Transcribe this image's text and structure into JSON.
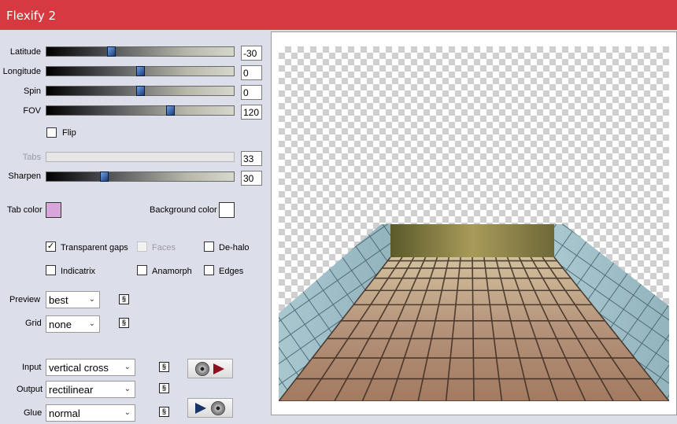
{
  "window": {
    "title": "Flexify 2"
  },
  "sliders": [
    {
      "label": "Latitude",
      "value": "-30",
      "thumb_pct": 0.34,
      "enabled": true
    },
    {
      "label": "Longitude",
      "value": "0",
      "thumb_pct": 0.5,
      "enabled": true
    },
    {
      "label": "Spin",
      "value": "0",
      "thumb_pct": 0.5,
      "enabled": true
    },
    {
      "label": "FOV",
      "value": "120",
      "thumb_pct": 0.66,
      "enabled": true
    },
    {
      "label": "Tabs",
      "value": "33",
      "thumb_pct": 0.0,
      "enabled": false
    },
    {
      "label": "Sharpen",
      "value": "30",
      "thumb_pct": 0.3,
      "enabled": true
    }
  ],
  "flip": {
    "label": "Flip",
    "checked": false
  },
  "colors": {
    "tab_color_label": "Tab color",
    "tab_color": "#d9a6db",
    "background_color_label": "Background color",
    "background_color": "#ffffff",
    "titlebar": "#d63a40"
  },
  "checkboxes": {
    "transparent_gaps": {
      "label": "Transparent gaps",
      "checked": true
    },
    "faces": {
      "label": "Faces",
      "checked": false,
      "enabled": false
    },
    "de_halo": {
      "label": "De-halo",
      "checked": false
    },
    "indicatrix": {
      "label": "Indicatrix",
      "checked": false
    },
    "anamorph": {
      "label": "Anamorph",
      "checked": false
    },
    "edges": {
      "label": "Edges",
      "checked": false
    }
  },
  "dropdowns": {
    "preview": {
      "label": "Preview",
      "value": "best"
    },
    "grid": {
      "label": "Grid",
      "value": "none"
    },
    "input": {
      "label": "Input",
      "value": "vertical cross"
    },
    "output": {
      "label": "Output",
      "value": "rectilinear"
    },
    "glue": {
      "label": "Glue",
      "value": "normal"
    }
  },
  "icons": {
    "link": "link-icon",
    "input_button": "disc-arrow-icon",
    "glue_button": "arrow-disc-icon"
  }
}
